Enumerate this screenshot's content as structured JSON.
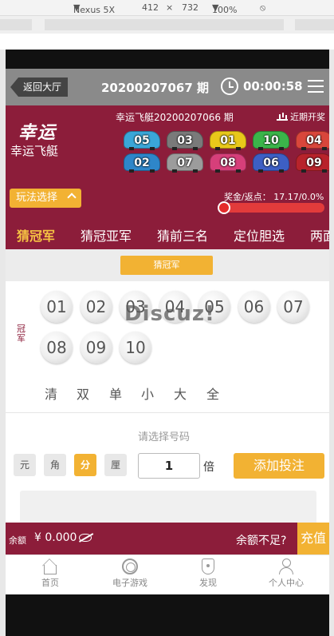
{
  "devtools": {
    "device": "Nexus 5X",
    "width": "412",
    "times": "×",
    "height": "732",
    "zoom": "100%"
  },
  "header": {
    "back_label": "返回大厅",
    "period_title": "20200207067 期",
    "countdown": "00:00:58"
  },
  "game": {
    "logo_text": "幸运",
    "name": "幸运飞艇",
    "last_period": "幸运飞艇20200207066 期",
    "recent_link": "近期开奖"
  },
  "results": [
    {
      "num": "05",
      "color": "#3aa6d8"
    },
    {
      "num": "03",
      "color": "#7a7a7a"
    },
    {
      "num": "01",
      "color": "#e8c81a"
    },
    {
      "num": "10",
      "color": "#3bb54a"
    },
    {
      "num": "04",
      "color": "#d9463b"
    },
    {
      "num": "02",
      "color": "#2e86c9"
    },
    {
      "num": "07",
      "color": "#9c9c9c"
    },
    {
      "num": "08",
      "color": "#d63f7a"
    },
    {
      "num": "06",
      "color": "#3d5fc4"
    },
    {
      "num": "09",
      "color": "#b8232b"
    }
  ],
  "controls": {
    "play_select": "玩法选择",
    "rebate_text": "奖金/返点： 17.17/0.0%",
    "rebate_level": 0.0
  },
  "tabs": [
    {
      "label": "猜冠军",
      "active": true
    },
    {
      "label": "猜冠亚军",
      "active": false
    },
    {
      "label": "猜前三名",
      "active": false
    },
    {
      "label": "定位胆选",
      "active": false
    },
    {
      "label": "两面",
      "active": false
    }
  ],
  "section": {
    "title": "猜冠军",
    "side_label": "冠军",
    "watermark": "Discuz!"
  },
  "numbers": [
    "01",
    "02",
    "03",
    "04",
    "05",
    "06",
    "07",
    "08",
    "09",
    "10"
  ],
  "quick_select": [
    "清",
    "双",
    "单",
    "小",
    "大",
    "全"
  ],
  "bet": {
    "prompt": "请选择号码",
    "units": [
      {
        "label": "元",
        "active": false
      },
      {
        "label": "角",
        "active": false
      },
      {
        "label": "分",
        "active": true
      },
      {
        "label": "厘",
        "active": false
      }
    ],
    "multiplier": "1",
    "times_label": "倍",
    "add_label": "添加投注"
  },
  "balance": {
    "label": "余额",
    "amount": "¥ 0.000",
    "insufficient": "余额不足?",
    "recharge": "充值"
  },
  "nav": [
    {
      "label": "首页",
      "icon": "home-icon"
    },
    {
      "label": "电子游戏",
      "icon": "game-icon"
    },
    {
      "label": "发现",
      "icon": "discover-icon"
    },
    {
      "label": "个人中心",
      "icon": "user-icon"
    }
  ]
}
